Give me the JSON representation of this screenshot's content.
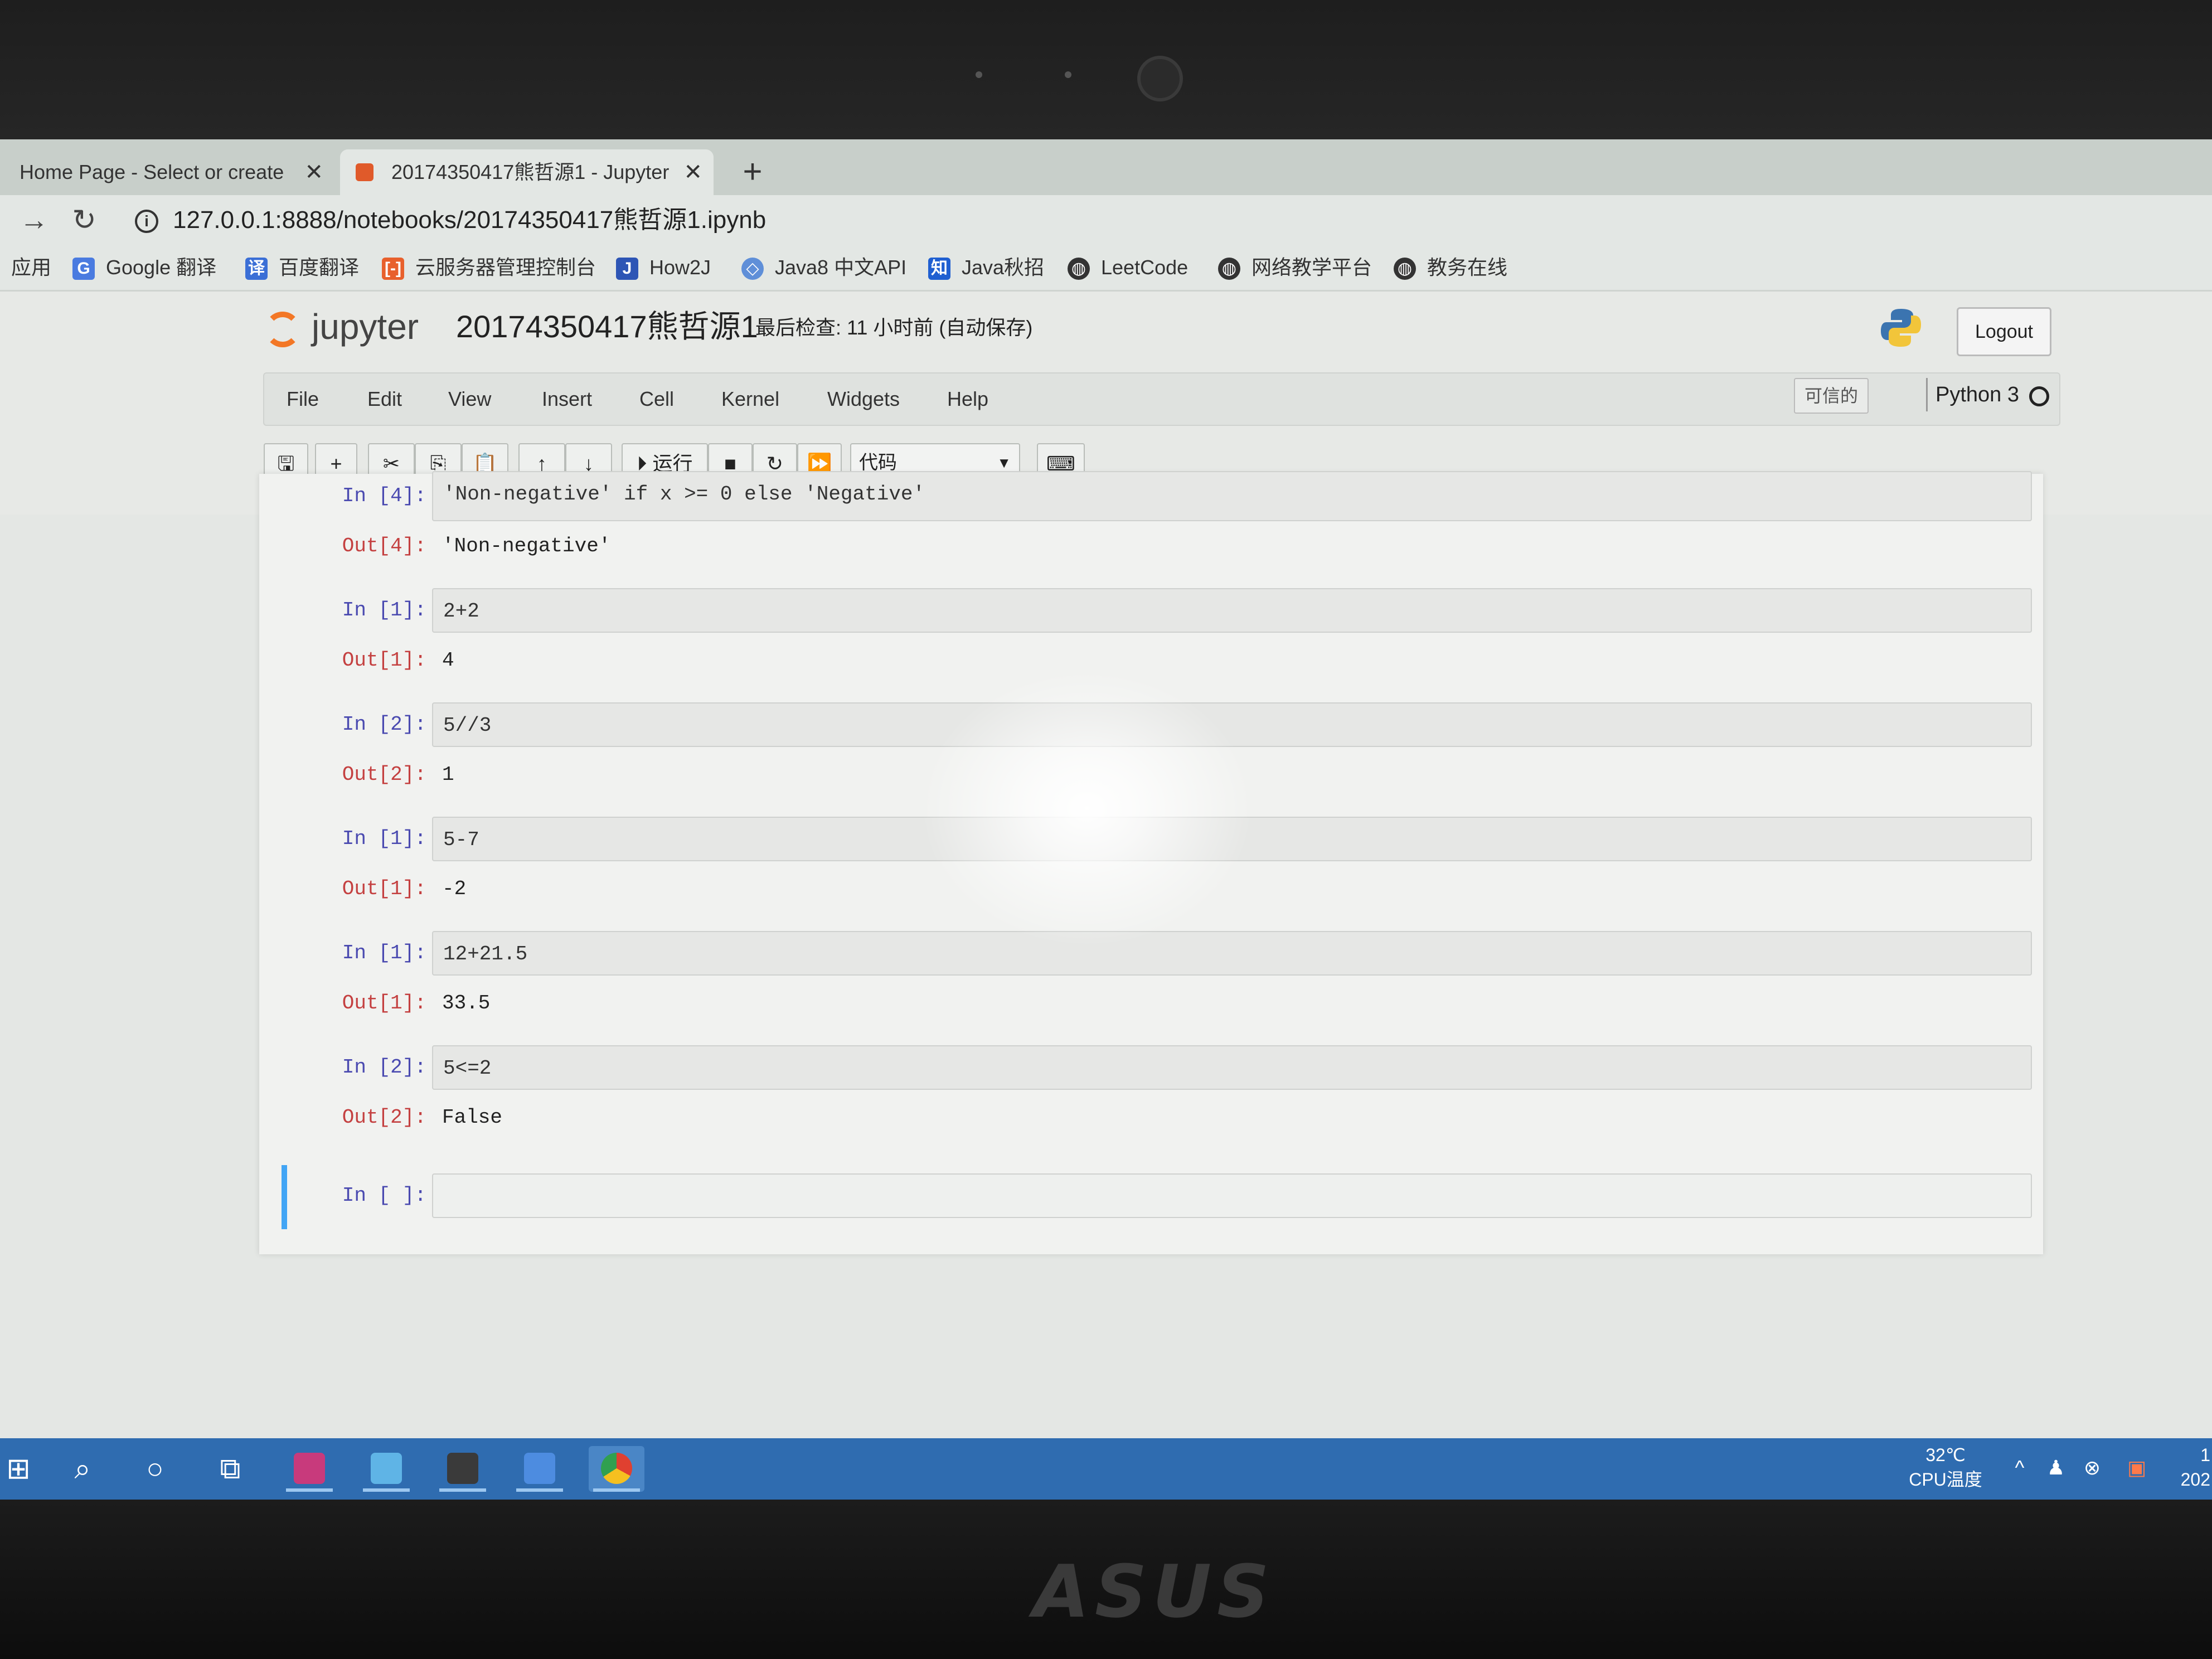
{
  "browser": {
    "tabs": [
      {
        "title": "Home Page - Select or create",
        "close": "✕"
      },
      {
        "title": "20174350417熊哲源1 - Jupyter",
        "close": "✕"
      }
    ],
    "new_tab": "+",
    "url": "127.0.0.1:8888/notebooks/20174350417熊哲源1.ipynb",
    "bookmarks": [
      {
        "label": "应用",
        "icon": "apps-grid-icon"
      },
      {
        "label": "Google 翻译",
        "icon": "google-translate-icon"
      },
      {
        "label": "百度翻译",
        "icon": "baidu-translate-icon"
      },
      {
        "label": "云服务器管理控制台",
        "icon": "aliyun-icon"
      },
      {
        "label": "How2J",
        "icon": "how2j-icon"
      },
      {
        "label": "Java8 中文API",
        "icon": "java-api-icon"
      },
      {
        "label": "Java秋招",
        "icon": "zhihu-icon"
      },
      {
        "label": "LeetCode",
        "icon": "globe-icon"
      },
      {
        "label": "网络教学平台",
        "icon": "globe-icon"
      },
      {
        "label": "教务在线",
        "icon": "globe-icon"
      }
    ]
  },
  "jupyter": {
    "logo_text": "jupyter",
    "notebook_name": "20174350417熊哲源1",
    "checkpoint": "最后检查: 11 小时前 (自动保存)",
    "logout_label": "Logout",
    "menu": [
      "File",
      "Edit",
      "View",
      "Insert",
      "Cell",
      "Kernel",
      "Widgets",
      "Help"
    ],
    "trusted_label": "可信的",
    "kernel_name": "Python 3",
    "toolbar": {
      "run_label": "运行",
      "cell_type": "代码"
    }
  },
  "cells": [
    {
      "in_prompt": "In  [4]:",
      "out_prompt": "Out[4]:",
      "input": "'Non-negative' if x >= 0 else 'Negative'",
      "output": "'Non-negative'"
    },
    {
      "in_prompt": "In  [1]:",
      "out_prompt": "Out[1]:",
      "input": "2+2",
      "output": "4"
    },
    {
      "in_prompt": "In  [2]:",
      "out_prompt": "Out[2]:",
      "input": "5//3",
      "output": "1"
    },
    {
      "in_prompt": "In  [1]:",
      "out_prompt": "Out[1]:",
      "input": "5-7",
      "output": "-2"
    },
    {
      "in_prompt": "In  [1]:",
      "out_prompt": "Out[1]:",
      "input": "12+21.5",
      "output": "33.5"
    },
    {
      "in_prompt": "In  [2]:",
      "out_prompt": "Out[2]:",
      "input": "5<=2",
      "output": "False"
    },
    {
      "in_prompt": "In  [ ]:",
      "input": ""
    }
  ],
  "taskbar": {
    "temperature": "32℃",
    "temp_label": "CPU温度",
    "clock_partial_1": "1",
    "clock_partial_2": "202"
  },
  "bezel": {
    "brand": "ASUS"
  }
}
